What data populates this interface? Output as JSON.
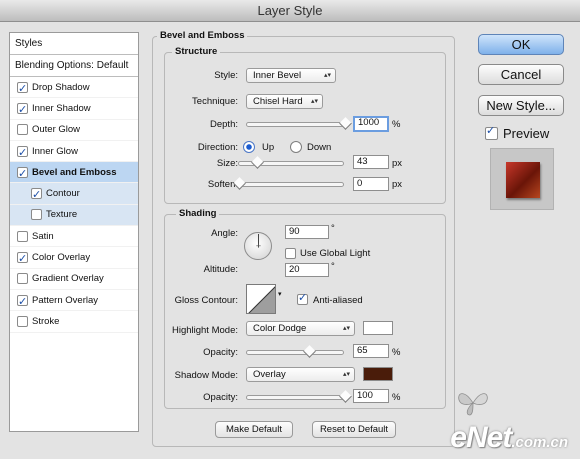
{
  "window": {
    "title": "Layer Style"
  },
  "sidebar": {
    "header": "Styles",
    "blending": "Blending Options: Default",
    "items": [
      {
        "label": "Drop Shadow",
        "checked": true
      },
      {
        "label": "Inner Shadow",
        "checked": true
      },
      {
        "label": "Outer Glow",
        "checked": false
      },
      {
        "label": "Inner Glow",
        "checked": true
      },
      {
        "label": "Bevel and Emboss",
        "checked": true,
        "selected": true
      },
      {
        "label": "Contour",
        "checked": true,
        "sub": true
      },
      {
        "label": "Texture",
        "checked": false,
        "sub": true
      },
      {
        "label": "Satin",
        "checked": false
      },
      {
        "label": "Color Overlay",
        "checked": true
      },
      {
        "label": "Gradient Overlay",
        "checked": false
      },
      {
        "label": "Pattern Overlay",
        "checked": true
      },
      {
        "label": "Stroke",
        "checked": false
      }
    ]
  },
  "panel": {
    "title": "Bevel and Emboss",
    "structure": {
      "title": "Structure",
      "style_label": "Style:",
      "style_value": "Inner Bevel",
      "technique_label": "Technique:",
      "technique_value": "Chisel Hard",
      "depth_label": "Depth:",
      "depth_value": "1000",
      "depth_unit": "%",
      "depth_level": 1.0,
      "direction_label": "Direction:",
      "direction_up": "Up",
      "direction_down": "Down",
      "direction_selected": "Up",
      "size_label": "Size:",
      "size_value": "43",
      "size_unit": "px",
      "size_level": 0.17,
      "soften_label": "Soften:",
      "soften_value": "0",
      "soften_unit": "px",
      "soften_level": 0.0
    },
    "shading": {
      "title": "Shading",
      "angle_label": "Angle:",
      "angle_value": "90",
      "angle_unit": "°",
      "use_global_light": "Use Global Light",
      "use_global_light_checked": false,
      "altitude_label": "Altitude:",
      "altitude_value": "20",
      "altitude_unit": "°",
      "gloss_contour_label": "Gloss Contour:",
      "anti_aliased": "Anti-aliased",
      "anti_aliased_checked": true,
      "highlight_mode_label": "Highlight Mode:",
      "highlight_mode_value": "Color Dodge",
      "highlight_color": "#ffffff",
      "highlight_opacity_label": "Opacity:",
      "highlight_opacity_value": "65",
      "highlight_opacity_unit": "%",
      "highlight_opacity_level": 0.65,
      "shadow_mode_label": "Shadow Mode:",
      "shadow_mode_value": "Overlay",
      "shadow_color": "#4a1c0a",
      "shadow_opacity_label": "Opacity:",
      "shadow_opacity_value": "100",
      "shadow_opacity_unit": "%",
      "shadow_opacity_level": 1.0
    },
    "make_default": "Make Default",
    "reset_default": "Reset to Default"
  },
  "actions": {
    "ok": "OK",
    "cancel": "Cancel",
    "new_style": "New Style...",
    "preview": "Preview",
    "preview_checked": true
  },
  "watermark": {
    "main": "eNet",
    "suffix": ".com.cn"
  }
}
